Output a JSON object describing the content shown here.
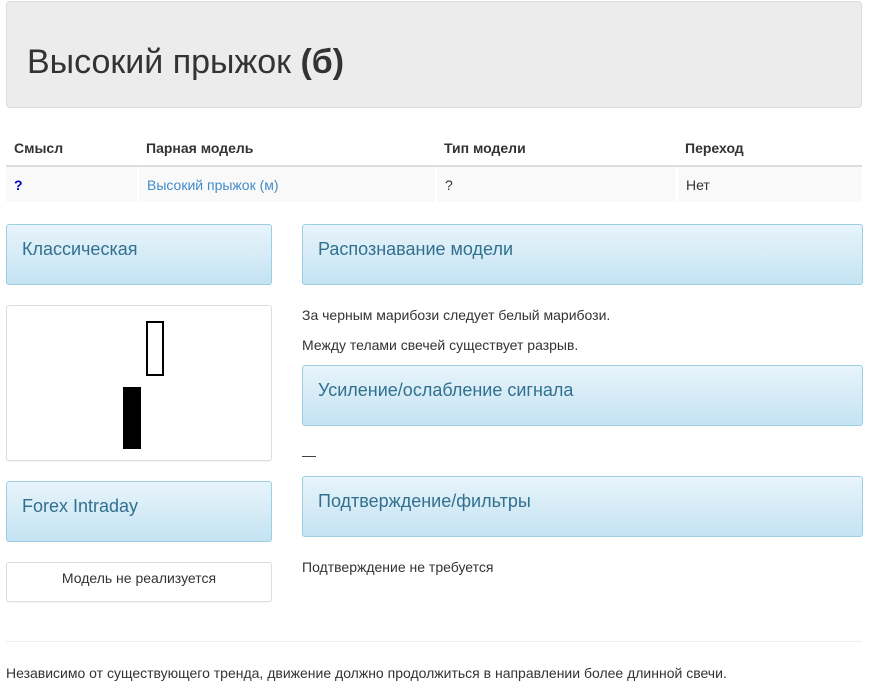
{
  "header": {
    "title_main": "Высокий прыжок",
    "title_suffix": "(б)"
  },
  "info_table": {
    "headers": [
      "Смысл",
      "Парная модель",
      "Тип модели",
      "Переход"
    ],
    "row": {
      "meaning": "?",
      "paired_model": "Высокий прыжок (м)",
      "model_type": "?",
      "transition": "Нет"
    }
  },
  "left": {
    "classic_title": "Классическая",
    "forex_title": "Forex Intraday",
    "forex_text": "Модель не реализуется"
  },
  "right": {
    "recognition_title": "Распознавание модели",
    "recognition_lines": [
      "За черным марибози следует белый марибози.",
      "Между телами свечей существует разрыв."
    ],
    "signal_title": "Усиление/ослабление сигнала",
    "signal_text": "—",
    "confirm_title": "Подтверждение/фильтры",
    "confirm_text": "Подтверждение не требуется"
  },
  "footer_text": "Независимо от существующего тренда, движение должно продолжиться в направлении более длинной свечи.",
  "candles": [
    {
      "color": "black",
      "name": "black-marubozu-candle"
    },
    {
      "color": "white",
      "name": "white-marubozu-candle"
    }
  ]
}
